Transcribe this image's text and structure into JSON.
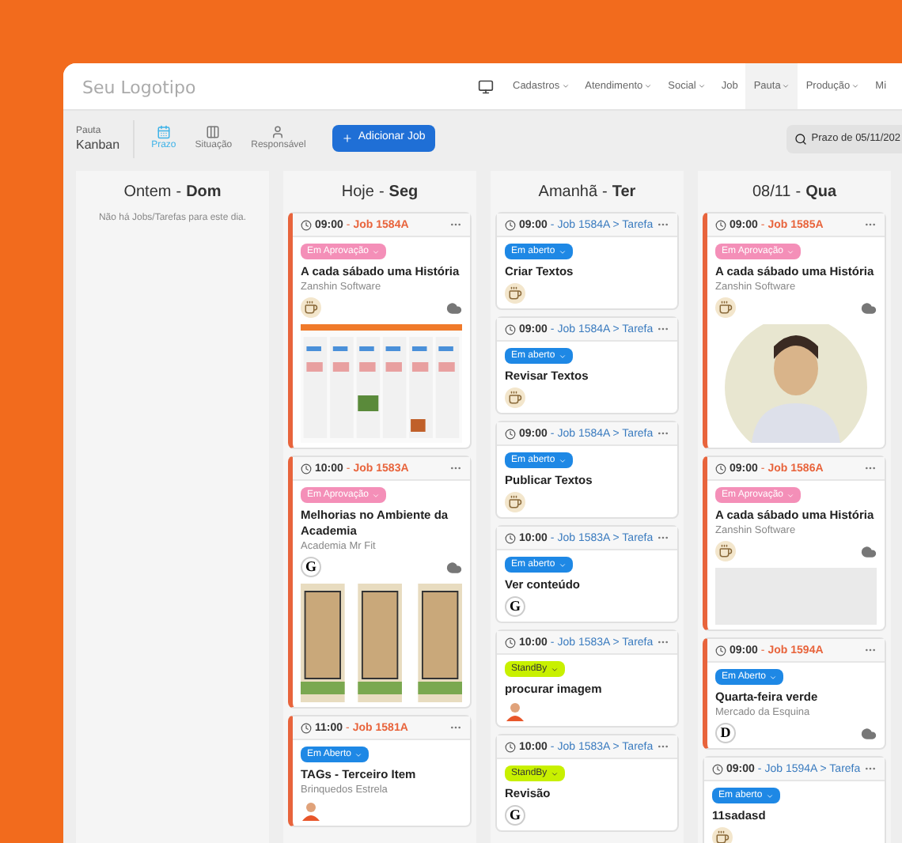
{
  "logo": "Seu Logotipo",
  "nav": [
    {
      "kind": "monitor"
    },
    {
      "kind": "item",
      "label": "Cadastros",
      "dropdown": true,
      "selected": false
    },
    {
      "kind": "item",
      "label": "Atendimento",
      "dropdown": true,
      "selected": false
    },
    {
      "kind": "item",
      "label": "Social",
      "dropdown": true,
      "selected": false
    },
    {
      "kind": "item",
      "label": "Job",
      "dropdown": false,
      "selected": false
    },
    {
      "kind": "item",
      "label": "Pauta",
      "dropdown": true,
      "selected": true
    },
    {
      "kind": "item",
      "label": "Produção",
      "dropdown": true,
      "selected": false
    },
    {
      "kind": "item",
      "label": "Mi",
      "dropdown": false,
      "selected": false
    }
  ],
  "page_title": {
    "section": "Pauta",
    "name": "Kanban"
  },
  "views": [
    {
      "label": "Prazo",
      "selected": true
    },
    {
      "label": "Situação",
      "selected": false
    },
    {
      "label": "Responsável",
      "selected": false
    }
  ],
  "add_button": "Adicionar Job",
  "search": {
    "value": "Prazo de 05/11/202"
  },
  "columns": [
    {
      "day": "Ontem",
      "sep": "-",
      "weekday": "Dom",
      "empty_message": "Não há Jobs/Tarefas para este dia."
    },
    {
      "day": "Hoje",
      "sep": "-",
      "weekday": "Seg",
      "cards": [
        {
          "kind": "job",
          "time": "09:00",
          "sep": "-",
          "ref": "Job 1584A",
          "status": {
            "label": "Em Aprovação",
            "kind": "approval"
          },
          "title": "A cada sábado uma História",
          "client": "Zanshin Software",
          "avatar": {
            "kind": "coffee"
          },
          "cloud": true,
          "image": {
            "kind": "screenshot"
          }
        },
        {
          "kind": "job",
          "time": "10:00",
          "sep": "-",
          "ref": "Job 1583A",
          "status": {
            "label": "Em Aprovação",
            "kind": "approval"
          },
          "title": "Melhorias no Ambiente da Academia",
          "client": "Academia Mr Fit",
          "avatar": {
            "kind": "letter",
            "text": "G"
          },
          "cloud": true,
          "image": {
            "kind": "floorplan"
          }
        },
        {
          "kind": "job",
          "time": "11:00",
          "sep": "-",
          "ref": "Job 1581A",
          "status": {
            "label": "Em Aberto",
            "kind": "open"
          },
          "title": "TAGs - Terceiro Item",
          "client": "Brinquedos Estrela",
          "avatar": {
            "kind": "person"
          },
          "cloud": false
        }
      ]
    },
    {
      "day": "Amanhã",
      "sep": "-",
      "weekday": "Ter",
      "cards": [
        {
          "kind": "task",
          "time": "09:00",
          "sep": "-",
          "ref": "Job 1584A > Tarefa",
          "status": {
            "label": "Em aberto",
            "kind": "open"
          },
          "title": "Criar Textos",
          "avatar": {
            "kind": "coffee"
          },
          "cloud": false
        },
        {
          "kind": "task",
          "time": "09:00",
          "sep": "-",
          "ref": "Job 1584A > Tarefa",
          "status": {
            "label": "Em aberto",
            "kind": "open"
          },
          "title": "Revisar Textos",
          "avatar": {
            "kind": "coffee"
          },
          "cloud": false
        },
        {
          "kind": "task",
          "time": "09:00",
          "sep": "-",
          "ref": "Job 1584A > Tarefa",
          "status": {
            "label": "Em aberto",
            "kind": "open"
          },
          "title": "Publicar Textos",
          "avatar": {
            "kind": "coffee"
          },
          "cloud": false
        },
        {
          "kind": "task",
          "time": "10:00",
          "sep": "-",
          "ref": "Job 1583A > Tarefa",
          "status": {
            "label": "Em aberto",
            "kind": "open"
          },
          "title": "Ver conteúdo",
          "avatar": {
            "kind": "letter",
            "text": "G"
          },
          "cloud": false
        },
        {
          "kind": "task",
          "time": "10:00",
          "sep": "-",
          "ref": "Job 1583A > Tarefa",
          "status": {
            "label": "StandBy",
            "kind": "standby"
          },
          "title": "procurar imagem",
          "avatar": {
            "kind": "person"
          },
          "cloud": false
        },
        {
          "kind": "task",
          "time": "10:00",
          "sep": "-",
          "ref": "Job 1583A > Tarefa",
          "status": {
            "label": "StandBy",
            "kind": "standby"
          },
          "title": "Revisão",
          "avatar": {
            "kind": "letter",
            "text": "G"
          },
          "cloud": false
        }
      ]
    },
    {
      "day": "08/11",
      "sep": "-",
      "weekday": "Qua",
      "cards": [
        {
          "kind": "job",
          "time": "09:00",
          "sep": "-",
          "ref": "Job 1585A",
          "status": {
            "label": "Em Aprovação",
            "kind": "approval"
          },
          "title": "A cada sábado uma História",
          "client": "Zanshin Software",
          "avatar": {
            "kind": "coffee"
          },
          "cloud": true,
          "image": {
            "kind": "portrait"
          }
        },
        {
          "kind": "job",
          "time": "09:00",
          "sep": "-",
          "ref": "Job 1586A",
          "status": {
            "label": "Em Aprovação",
            "kind": "approval"
          },
          "title": "A cada sábado uma História",
          "client": "Zanshin Software",
          "avatar": {
            "kind": "coffee"
          },
          "cloud": true,
          "image": {
            "kind": "logo"
          }
        },
        {
          "kind": "job",
          "time": "09:00",
          "sep": "-",
          "ref": "Job 1594A",
          "status": {
            "label": "Em Aberto",
            "kind": "open"
          },
          "title": "Quarta-feira verde",
          "client": "Mercado da Esquina",
          "avatar": {
            "kind": "letter",
            "text": "D"
          },
          "cloud": true
        },
        {
          "kind": "task",
          "time": "09:00",
          "sep": "-",
          "ref": "Job 1594A > Tarefa",
          "status": {
            "label": "Em aberto",
            "kind": "open"
          },
          "title": "11sadasd",
          "avatar": {
            "kind": "coffee"
          },
          "cloud": false
        }
      ]
    }
  ]
}
